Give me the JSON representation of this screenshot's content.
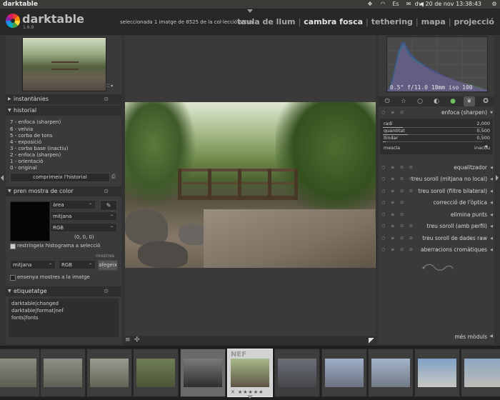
{
  "window": {
    "title": "darktable",
    "clock": "dv, 20 de nov 13:38:43"
  },
  "header": {
    "app_name": "darktable",
    "version": "1.6.9",
    "selection_info": "seleccionada 1 imatge de 8525 de la col·lecció actual",
    "views": [
      {
        "label": "taula de llum",
        "active": false
      },
      {
        "label": "cambra fosca",
        "active": true
      },
      {
        "label": "tethering",
        "active": false
      },
      {
        "label": "mapa",
        "active": false
      },
      {
        "label": "projecció",
        "active": false
      }
    ],
    "view_separator": "|"
  },
  "navigation": {
    "zoom_icon": "fit-icon",
    "zoom_caret": "▾"
  },
  "snapshots": {
    "title": "instantànies"
  },
  "history": {
    "title": "historial",
    "items": [
      "7 - enfoca (sharpen)",
      "6 - velvia",
      "5 - corba de tons",
      "4 - exposició",
      "3 - corba base (inactiu)",
      "2 - enfoca (sharpen)",
      "1 - orientació",
      "0 - original"
    ],
    "compress_button": "comprimeix l'historial"
  },
  "color_picker": {
    "title": "pren mostra de color",
    "mode": "àrea",
    "stat": "mitjana",
    "model": "RGB",
    "values": "(0, 0, 0)",
    "restrict_label": "restringeix histograma a selecció",
    "samples_label": "mostres",
    "sample_stat": "mitjana",
    "sample_model": "RGB",
    "add_button": "afegeix",
    "show_label": "ensenya mostres a la imatge"
  },
  "tagging": {
    "title": "etiquetatge",
    "tags": [
      "darktable|changed",
      "darktable|format|nef",
      "fonts|fonts"
    ]
  },
  "histogram": {
    "exif": "0.5\" f/11.0 18mm iso 100"
  },
  "module_groups": [
    "power-icon",
    "star-icon",
    "circle-icon",
    "half-circle-icon",
    "color-icon",
    "leaf-icon",
    "effect-icon"
  ],
  "active_module": {
    "name": "enfoca (sharpen)",
    "sliders": [
      {
        "label": "radi",
        "value": "2,000",
        "fraction": 0.2
      },
      {
        "label": "quantitat",
        "value": "0,500",
        "fraction": 0.25
      },
      {
        "label": "llindar",
        "value": "0,500",
        "fraction": 0.03
      }
    ],
    "blend_label": "mescla",
    "blend_value": "inactiu"
  },
  "modules": [
    "equalitzador",
    "treu soroll (mitjana no local)",
    "treu soroll (filtre bilateral)",
    "correcció de l'òptica",
    "elimina punts",
    "treu soroll (amb perfil)",
    "treu soroll de dades raw",
    "aberracions cromàtiques"
  ],
  "more_modules": "més mòduls",
  "filmstrip": {
    "selected_badge": "NEF",
    "stars": "★★★★★",
    "reject": "✕",
    "thumbnails": [
      {
        "name": "trees-1",
        "colors": [
          "#8a8a80",
          "#5b5e52"
        ]
      },
      {
        "name": "trees-2",
        "colors": [
          "#8f8f88",
          "#5f5f56"
        ]
      },
      {
        "name": "trees-3",
        "colors": [
          "#9a9a90",
          "#646456"
        ]
      },
      {
        "name": "forest-path",
        "colors": [
          "#6f7e55",
          "#4b5438"
        ]
      },
      {
        "name": "bridge-bw",
        "colors": [
          "#7a7a7a",
          "#2e2e2e"
        ]
      },
      {
        "name": "bridge-selected",
        "colors": [
          "#a7b98a",
          "#5e5545"
        ]
      },
      {
        "name": "street",
        "colors": [
          "#6b6e75",
          "#45474d"
        ]
      },
      {
        "name": "building-1",
        "colors": [
          "#9fb0c8",
          "#6b7280"
        ]
      },
      {
        "name": "building-2",
        "colors": [
          "#a5b4c9",
          "#727a87"
        ]
      },
      {
        "name": "building-3",
        "colors": [
          "#7fa0c6",
          "#c9c9c4"
        ]
      },
      {
        "name": "building-4",
        "colors": [
          "#8ca6c4",
          "#bdbdb6"
        ]
      }
    ]
  }
}
